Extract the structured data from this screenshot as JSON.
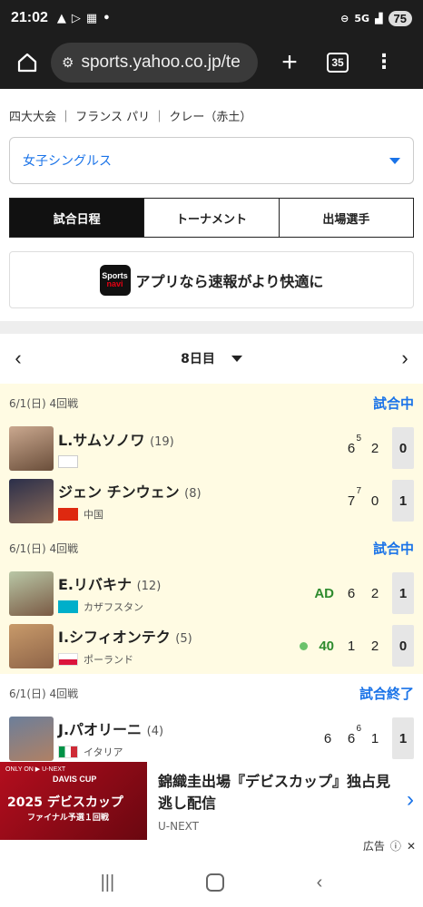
{
  "status_bar": {
    "time": "21:02",
    "network": "5G",
    "battery": "75"
  },
  "browser": {
    "url": "sports.yahoo.co.jp/te",
    "tab_count": "35"
  },
  "tournament": {
    "meta": "四大大会 ｜ フランス パリ ｜ クレー（赤土）"
  },
  "event_select": {
    "value": "女子シングルス"
  },
  "tabs": [
    {
      "label": "試合日程",
      "active": true
    },
    {
      "label": "トーナメント",
      "active": false
    },
    {
      "label": "出場選手",
      "active": false
    }
  ],
  "app_banner": {
    "logo_top": "Sports",
    "logo_bottom": "navi",
    "text": "アプリなら速報がより快適に"
  },
  "day_nav": {
    "label": "8日目"
  },
  "matches": [
    {
      "date_round": "6/1(日) 4回戦",
      "status": "試合中",
      "players": [
        {
          "name": "L.サムソノワ",
          "seed": "(19)",
          "country": "",
          "flag": "none",
          "point": "",
          "serving": false,
          "games": [
            {
              "v": "6",
              "tb": "5"
            },
            {
              "v": "2",
              "tb": ""
            }
          ],
          "sets": "0"
        },
        {
          "name": "ジェン チンウェン",
          "seed": "(8)",
          "country": "中国",
          "flag": "cn",
          "point": "",
          "serving": false,
          "games": [
            {
              "v": "7",
              "tb": "7"
            },
            {
              "v": "0",
              "tb": ""
            }
          ],
          "sets": "1"
        }
      ]
    },
    {
      "date_round": "6/1(日) 4回戦",
      "status": "試合中",
      "players": [
        {
          "name": "E.リバキナ",
          "seed": "(12)",
          "country": "カザフスタン",
          "flag": "kz",
          "point": "AD",
          "serving": false,
          "games": [
            {
              "v": "6",
              "tb": ""
            },
            {
              "v": "2",
              "tb": ""
            }
          ],
          "sets": "1"
        },
        {
          "name": "I.シフィオンテク",
          "seed": "(5)",
          "country": "ポーランド",
          "flag": "pl",
          "point": "40",
          "serving": true,
          "games": [
            {
              "v": "1",
              "tb": ""
            },
            {
              "v": "2",
              "tb": ""
            }
          ],
          "sets": "0"
        }
      ]
    },
    {
      "date_round": "6/1(日) 4回戦",
      "status": "試合終了",
      "players": [
        {
          "name": "J.パオリーニ",
          "seed": "(4)",
          "country": "イタリア",
          "flag": "it",
          "point": "",
          "serving": false,
          "games": [
            {
              "v": "6",
              "tb": ""
            },
            {
              "v": "6",
              "tb": "6"
            },
            {
              "v": "1",
              "tb": ""
            }
          ],
          "sets": "1"
        }
      ]
    }
  ],
  "ad": {
    "image_top": "ONLY ON ▶ U-NEXT",
    "image_brand": "DAVIS CUP",
    "image_title": "2025 デビスカップ",
    "image_sub": "ファイナル予選１回戦",
    "title": "錦織圭出場『デビスカップ』独占見逃し配信",
    "source": "U-NEXT",
    "label": "広告"
  },
  "colors": {
    "accent": "#1a73e8",
    "live_bg": "#fffbe3",
    "point_green": "#2e8b2e"
  }
}
